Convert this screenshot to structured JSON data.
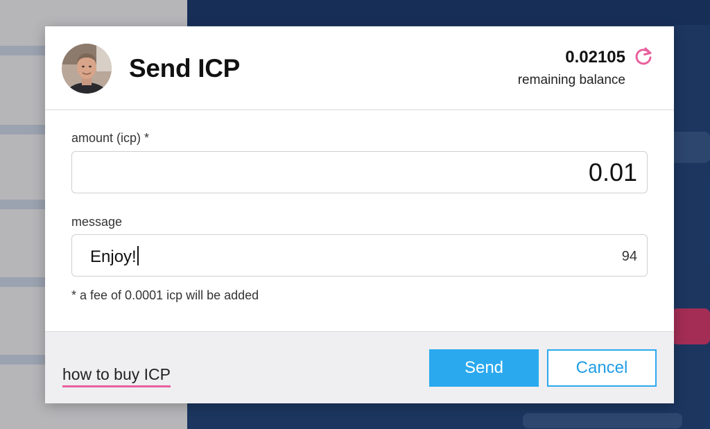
{
  "modal": {
    "title": "Send ICP",
    "balance": {
      "value": "0.02105",
      "label": "remaining balance"
    },
    "amount_field": {
      "label": "amount (icp) *",
      "value": "0.01"
    },
    "message_field": {
      "label": "message",
      "value": "Enjoy!",
      "remaining_chars": "94"
    },
    "fee_note": "* a fee of 0.0001 icp will be added",
    "footer": {
      "help_link": "how to buy ICP",
      "send_label": "Send",
      "cancel_label": "Cancel"
    }
  },
  "colors": {
    "accent": "#2aa9ef",
    "refresh_icon": "#e8609d",
    "link_underline": "#e8609d",
    "footer_bg": "#efeef0"
  },
  "icons": {
    "refresh": "refresh-icon",
    "avatar": "user-avatar"
  }
}
